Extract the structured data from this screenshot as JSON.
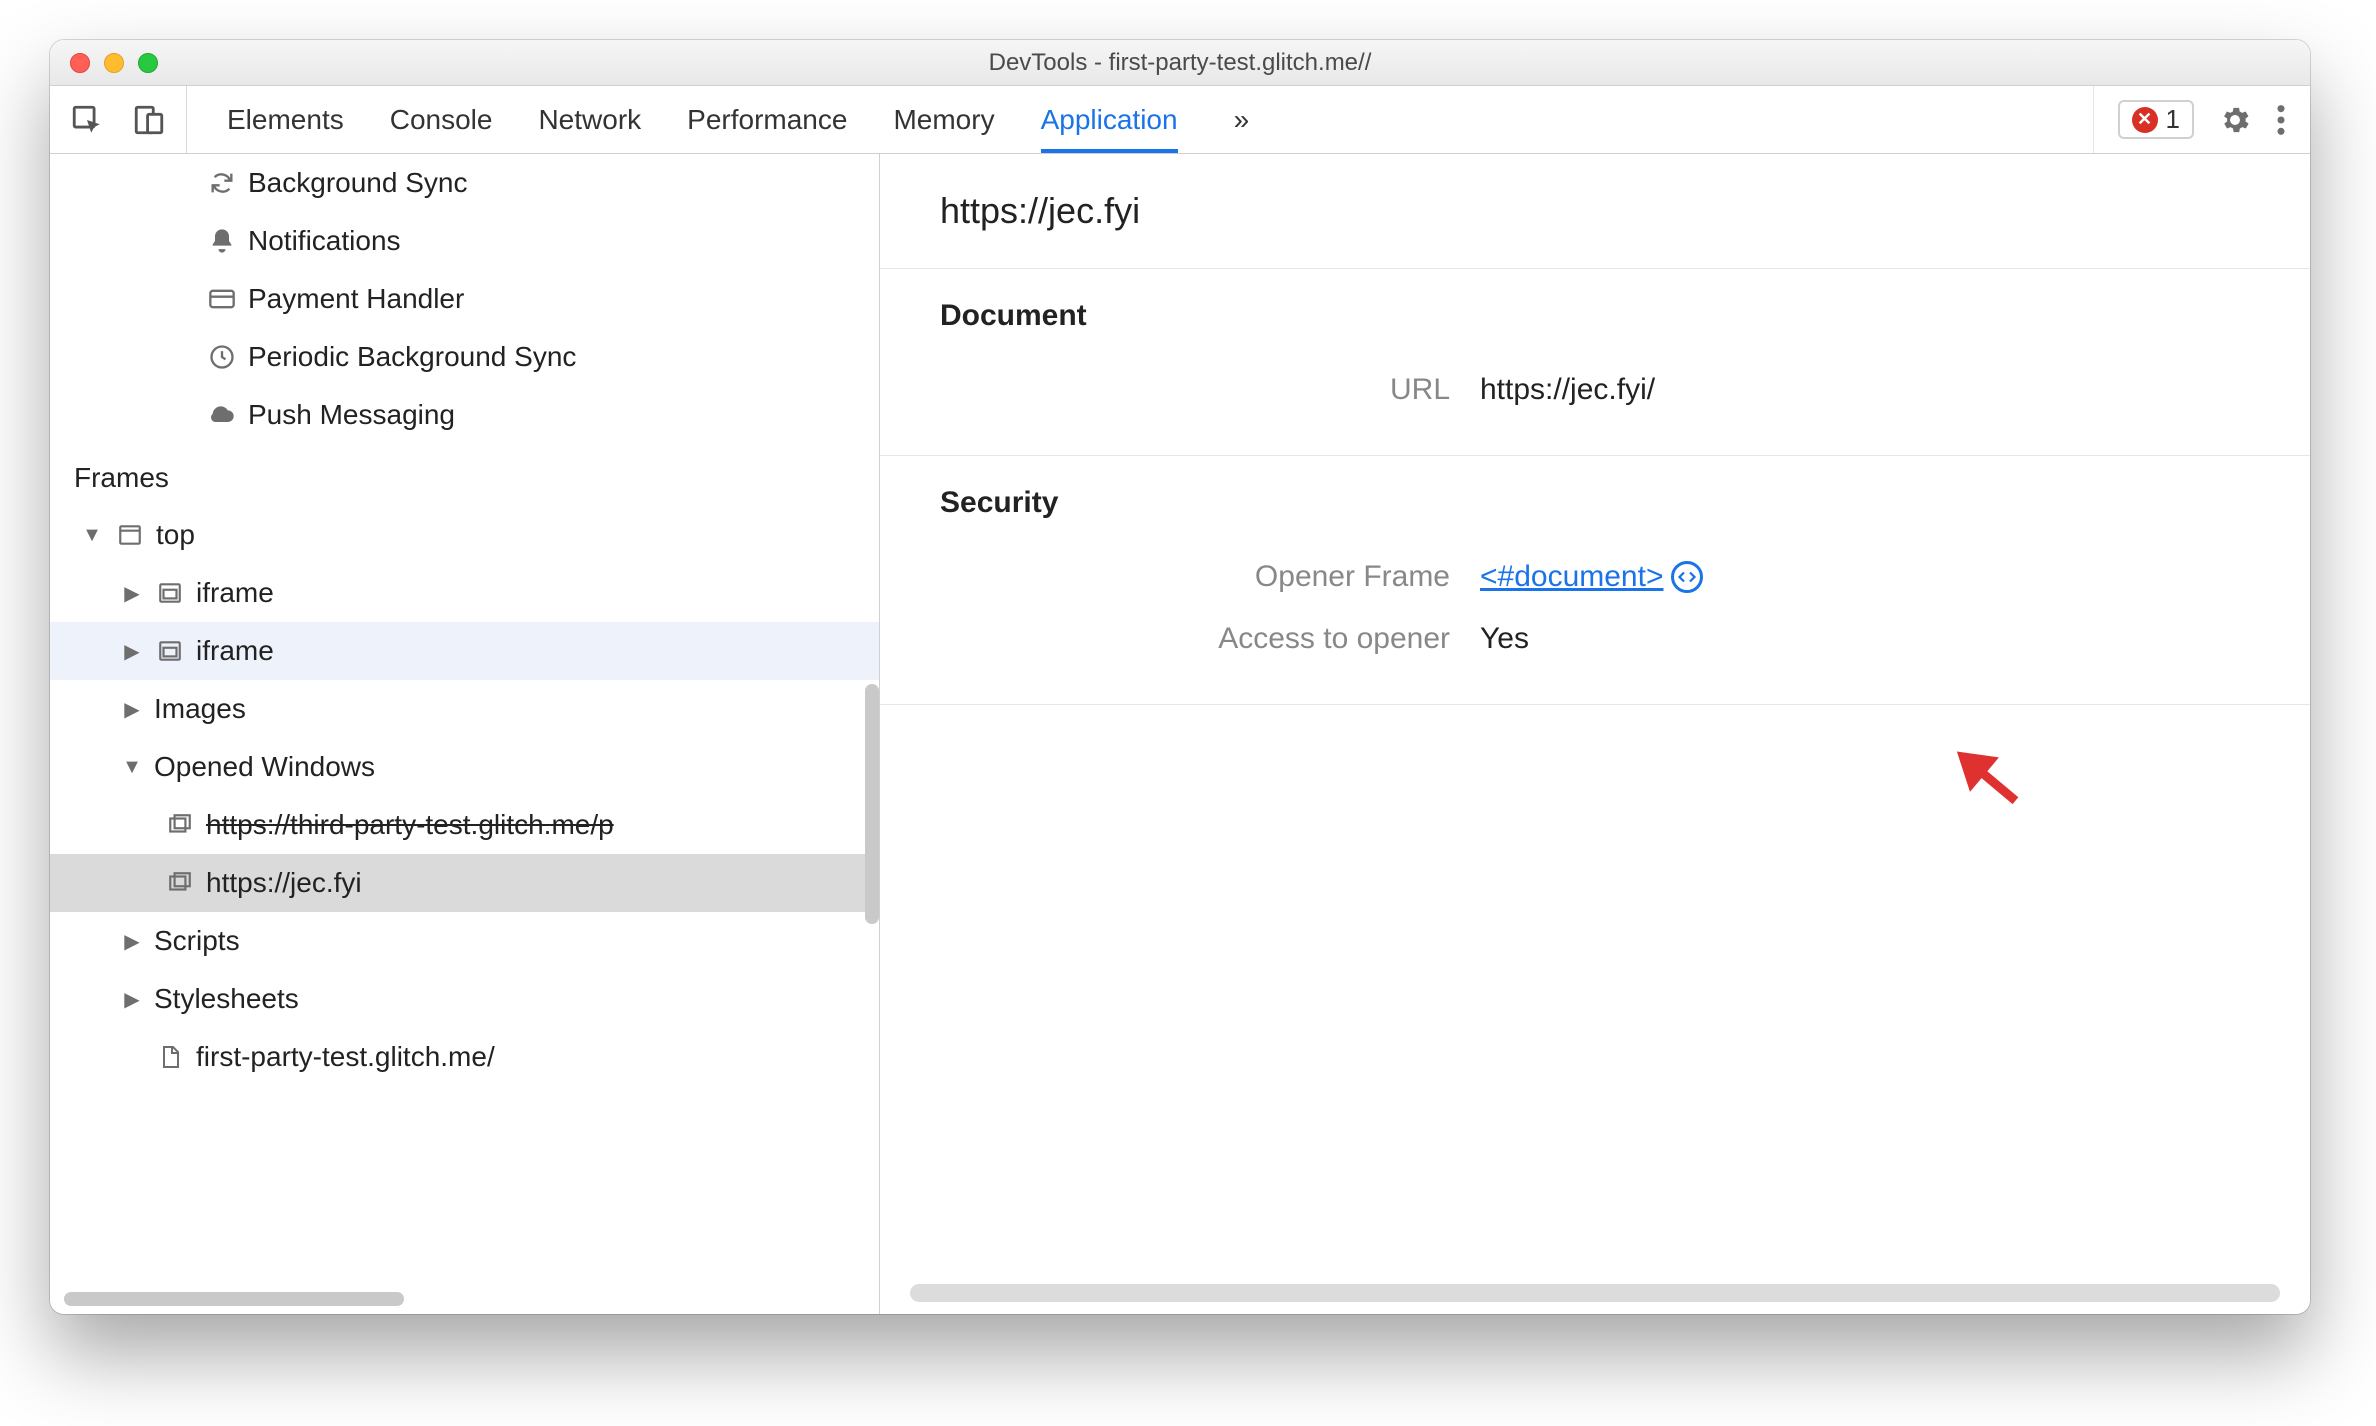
{
  "window": {
    "title": "DevTools - first-party-test.glitch.me//"
  },
  "toolbar": {
    "tabs": [
      "Elements",
      "Console",
      "Network",
      "Performance",
      "Memory",
      "Application"
    ],
    "active_tab": "Application",
    "more": "»",
    "error_count": "1"
  },
  "sidebar": {
    "bg_services": [
      {
        "label": "Background Sync",
        "icon": "sync"
      },
      {
        "label": "Notifications",
        "icon": "bell"
      },
      {
        "label": "Payment Handler",
        "icon": "card"
      },
      {
        "label": "Periodic Background Sync",
        "icon": "clock"
      },
      {
        "label": "Push Messaging",
        "icon": "cloud"
      }
    ],
    "frames_heading": "Frames",
    "tree": {
      "top_label": "top",
      "iframe1": "iframe",
      "iframe2": "iframe",
      "images": "Images",
      "opened_windows": "Opened Windows",
      "ow1": "https://third-party-test.glitch.me/p",
      "ow2": "https://jec.fyi",
      "scripts": "Scripts",
      "stylesheets": "Stylesheets",
      "docfile": "first-party-test.glitch.me/"
    }
  },
  "main": {
    "title": "https://jec.fyi",
    "document_heading": "Document",
    "url_label": "URL",
    "url_value": "https://jec.fyi/",
    "security_heading": "Security",
    "opener_label": "Opener Frame",
    "opener_value": "<#document>",
    "access_label": "Access to opener",
    "access_value": "Yes"
  }
}
